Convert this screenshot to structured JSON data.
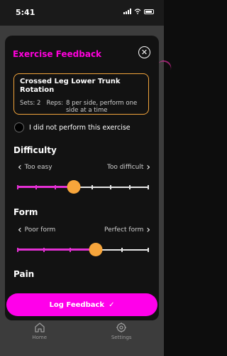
{
  "status_bar": {
    "time": "5:41"
  },
  "modal": {
    "title": "Exercise Feedback",
    "close_icon": "close-circle-icon",
    "exercise": {
      "name": "Crossed Leg Lower Trunk Rotation",
      "sets_label": "Sets:",
      "sets_value": "2",
      "reps_label": "Reps:",
      "reps_value": "8 per side, perform one side at a time"
    },
    "skip_label": "I did not perform this exercise",
    "difficulty": {
      "title": "Difficulty",
      "left_label": "Too easy",
      "right_label": "Too difficult",
      "steps": 8,
      "value_index": 3
    },
    "form": {
      "title": "Form",
      "left_label": "Poor form",
      "right_label": "Perfect form",
      "steps": 6,
      "value_index": 3
    },
    "pain": {
      "title": "Pain"
    }
  },
  "log_button": {
    "label": "Log Feedback",
    "icon": "check-icon"
  },
  "nav": {
    "items": [
      {
        "label": "Home",
        "icon": "home-icon"
      },
      {
        "label": "Settings",
        "icon": "settings-icon"
      }
    ]
  },
  "colors": {
    "accent": "#ff00dc",
    "thumb": "#f7a53b",
    "card_border": "#f0a33b"
  }
}
